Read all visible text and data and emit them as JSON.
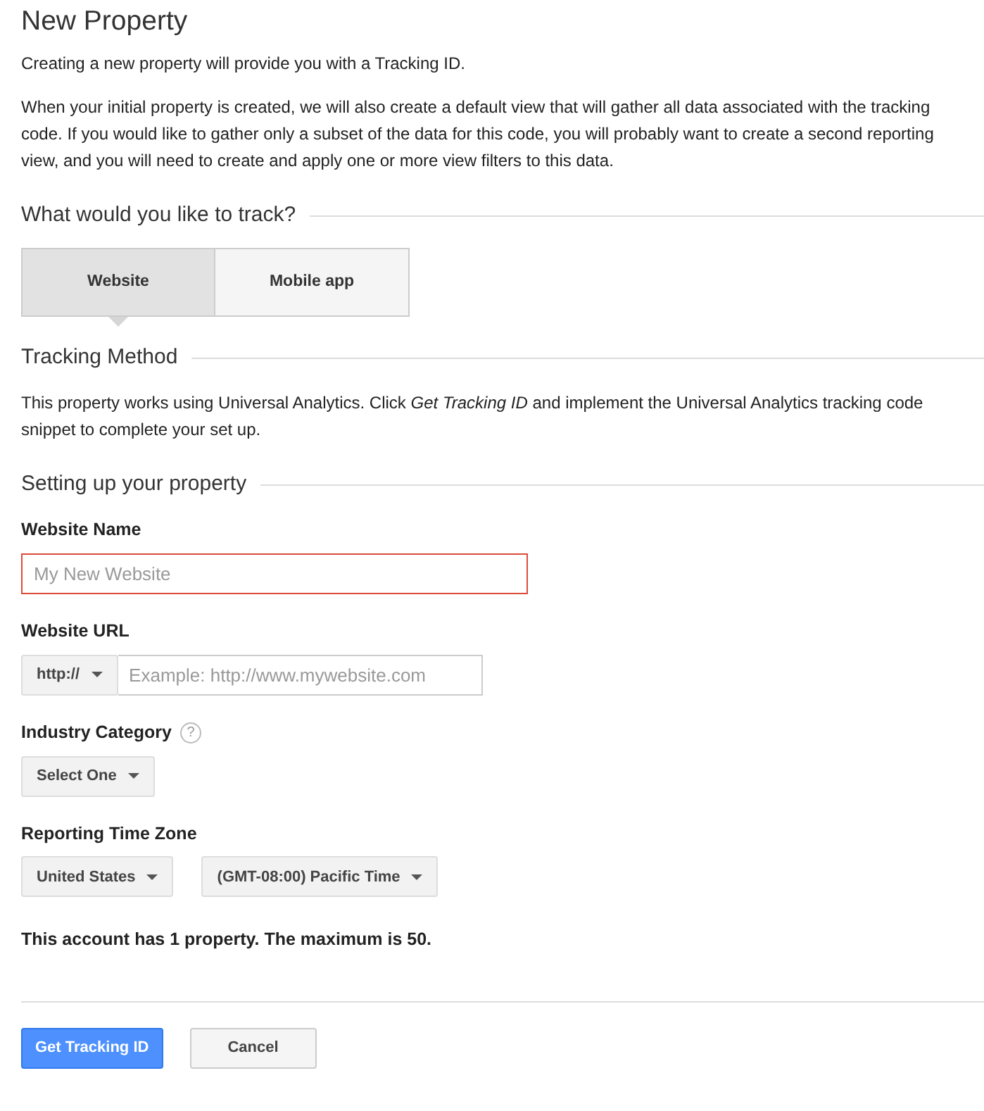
{
  "title": "New Property",
  "intro": [
    "Creating a new property will provide you with a Tracking ID.",
    "When your initial property is created, we will also create a default view that will gather all data associated with the tracking code. If you would like to gather only a subset of the data for this code, you will probably want to create a second reporting view, and you will need to create and apply one or more view filters to this data."
  ],
  "track_section": {
    "heading": "What would you like to track?",
    "options": [
      {
        "label": "Website",
        "selected": true
      },
      {
        "label": "Mobile app",
        "selected": false
      }
    ]
  },
  "method_section": {
    "heading": "Tracking Method",
    "text": "This property works using Universal Analytics. Click *Get Tracking ID* and implement the Universal Analytics tracking code snippet to complete your set up."
  },
  "setup_section": {
    "heading": "Setting up your property",
    "website_name": {
      "label": "Website Name",
      "placeholder": "My New Website",
      "invalid": true
    },
    "website_url": {
      "label": "Website URL",
      "protocol": "http://",
      "placeholder": "Example: http://www.mywebsite.com"
    },
    "industry": {
      "label": "Industry Category",
      "help": "?",
      "value": "Select One"
    },
    "time_zone": {
      "label": "Reporting Time Zone",
      "country": "United States",
      "zone": "(GMT-08:00) Pacific Time"
    },
    "note": "This account has 1 property. The maximum is 50."
  },
  "buttons": [
    {
      "label": "Get Tracking ID",
      "kind": "primary"
    },
    {
      "label": "Cancel",
      "kind": "default"
    }
  ]
}
